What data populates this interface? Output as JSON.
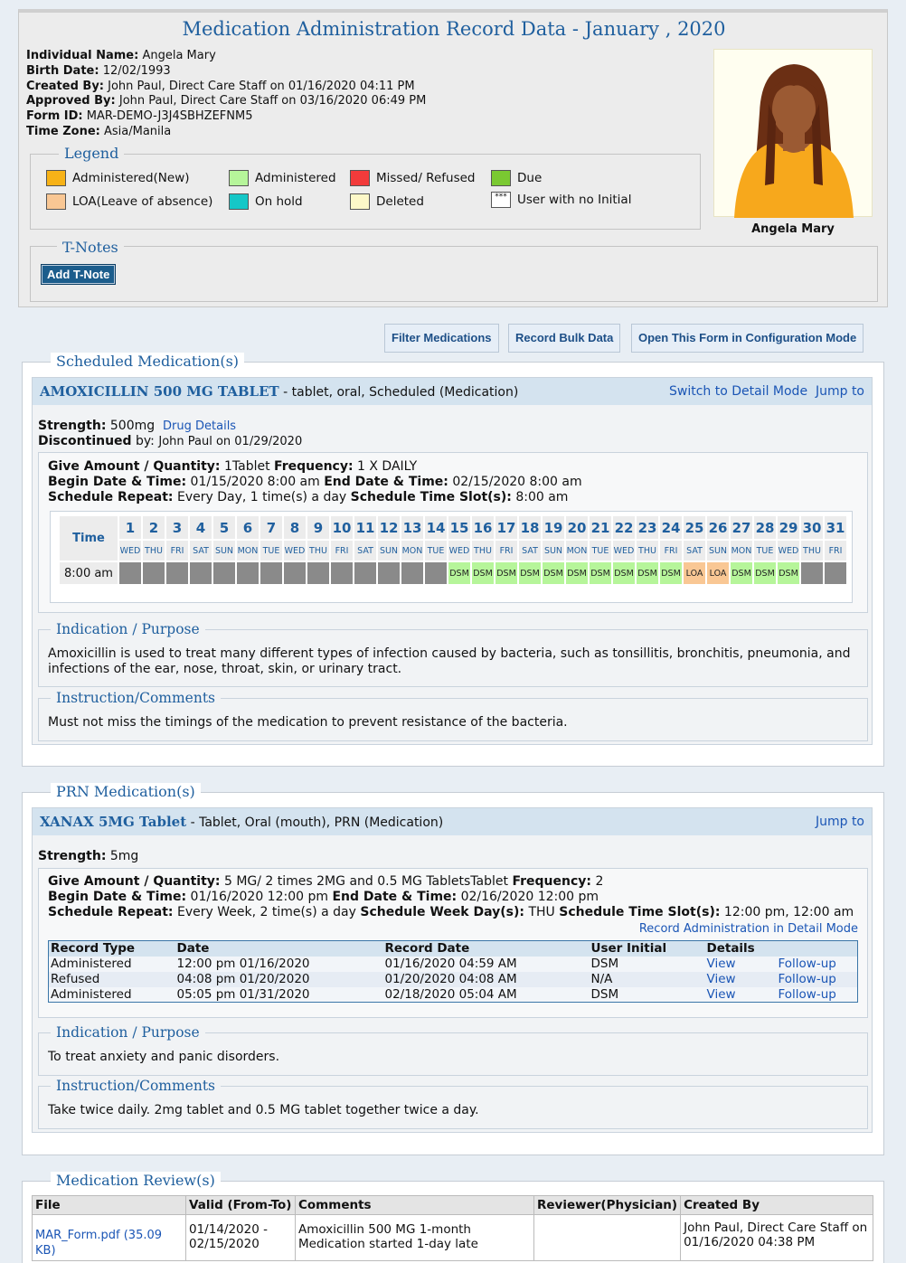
{
  "header": {
    "title": "Medication Administration Record Data - January , 2020",
    "info": [
      {
        "label": "Individual Name:",
        "value": "Angela Mary"
      },
      {
        "label": "Birth Date:",
        "value": "12/02/1993"
      },
      {
        "label": "Created By:",
        "value": "John Paul, Direct Care Staff on 01/16/2020 04:11 PM"
      },
      {
        "label": "Approved By:",
        "value": "John Paul, Direct Care Staff on 03/16/2020 06:49 PM"
      },
      {
        "label": "Form ID:",
        "value": "MAR-DEMO-J3J4SBHZEFNM5"
      },
      {
        "label": "Time Zone:",
        "value": "Asia/Manila"
      }
    ],
    "photo_name": "Angela Mary"
  },
  "legend": {
    "title": "Legend",
    "items": [
      {
        "label": "Administered(New)",
        "color": "#f7b217"
      },
      {
        "label": "Administered",
        "color": "#b6f59a"
      },
      {
        "label": "Missed/ Refused",
        "color": "#f23b3b"
      },
      {
        "label": "Due",
        "color": "#7ac931"
      },
      {
        "label": "LOA(Leave of absence)",
        "color": "#f9c794"
      },
      {
        "label": "On hold",
        "color": "#15c7c7"
      },
      {
        "label": "Deleted",
        "color": "#fdf8c8"
      },
      {
        "label": "User with no Initial",
        "color": "#ffffff",
        "glyph": "***"
      }
    ]
  },
  "tnotes": {
    "title": "T-Notes",
    "add_label": "Add T-Note"
  },
  "toolbar": {
    "filter": "Filter Medications",
    "bulk": "Record Bulk Data",
    "config": "Open This Form in Configuration Mode"
  },
  "scheduled": {
    "title": "Scheduled Medication(s)",
    "med": {
      "name": "AMOXICILLIN 500 MG TABLET",
      "desc": " - tablet, oral, Scheduled (Medication)",
      "switch_link": "Switch to Detail Mode",
      "jump_link": "Jump to",
      "strength_label": "Strength:",
      "strength": "500mg",
      "drug_details": "Drug Details",
      "disc_label": "Discontinued",
      "disc_by": "by:",
      "disc_value": "John Paul on 01/29/2020",
      "give_label": "Give Amount / Quantity:",
      "give_value": "1Tablet",
      "freq_label": "Frequency:",
      "freq_value": "1 X DAILY",
      "begin_label": "Begin Date & Time:",
      "begin_value": "01/15/2020 8:00 am",
      "end_label": "End Date & Time:",
      "end_value": "02/15/2020 8:00 am",
      "repeat_label": "Schedule Repeat:",
      "repeat_value": "Every Day, 1 time(s) a day",
      "slot_label": "Schedule Time Slot(s):",
      "slot_value": "8:00 am",
      "calendar": {
        "time_header": "Time",
        "days": [
          "1",
          "2",
          "3",
          "4",
          "5",
          "6",
          "7",
          "8",
          "9",
          "10",
          "11",
          "12",
          "13",
          "14",
          "15",
          "16",
          "17",
          "18",
          "19",
          "20",
          "21",
          "22",
          "23",
          "24",
          "25",
          "26",
          "27",
          "28",
          "29",
          "30",
          "31"
        ],
        "weekdays": [
          "WED",
          "THU",
          "FRI",
          "SAT",
          "SUN",
          "MON",
          "TUE",
          "WED",
          "THU",
          "FRI",
          "SAT",
          "SUN",
          "MON",
          "TUE",
          "WED",
          "THU",
          "FRI",
          "SAT",
          "SUN",
          "MON",
          "TUE",
          "WED",
          "THU",
          "FRI",
          "SAT",
          "SUN",
          "MON",
          "TUE",
          "WED",
          "THU",
          "FRI"
        ],
        "slot_time": "8:00 am",
        "cells": [
          "",
          "",
          "",
          "",
          "",
          "",
          "",
          "",
          "",
          "",
          "",
          "",
          "",
          "",
          "DSM",
          "DSM",
          "DSM",
          "DSM",
          "DSM",
          "DSM",
          "DSM",
          "DSM",
          "DSM",
          "DSM",
          "LOA",
          "LOA",
          "DSM",
          "DSM",
          "DSM",
          "",
          ""
        ],
        "cell_states": [
          "grey",
          "grey",
          "grey",
          "grey",
          "grey",
          "grey",
          "grey",
          "grey",
          "grey",
          "grey",
          "grey",
          "grey",
          "grey",
          "grey",
          "dsm",
          "dsm",
          "dsm",
          "dsm",
          "dsm",
          "dsm",
          "dsm",
          "dsm",
          "dsm",
          "dsm",
          "loa",
          "loa",
          "dsm",
          "dsm",
          "dsm",
          "grey",
          "grey"
        ]
      },
      "indication_title": "Indication / Purpose",
      "indication": "Amoxicillin is used to treat many different types of infection caused by bacteria, such as tonsillitis, bronchitis, pneumonia, and infections of the ear, nose, throat, skin, or urinary tract.",
      "instruction_title": "Instruction/Comments",
      "instruction": "Must not miss the timings of the medication to prevent resistance of the bacteria."
    }
  },
  "prn": {
    "title": "PRN Medication(s)",
    "med": {
      "name": "XANAX 5MG Tablet",
      "desc": " - Tablet, Oral (mouth), PRN (Medication)",
      "jump_link": "Jump to",
      "strength_label": "Strength:",
      "strength": "5mg",
      "give_label": "Give Amount / Quantity:",
      "give_value": "5 MG/ 2 times 2MG and 0.5 MG TabletsTablet",
      "freq_label": "Frequency:",
      "freq_value": "2",
      "begin_label": "Begin Date & Time:",
      "begin_value": "01/16/2020 12:00 pm",
      "end_label": "End Date & Time:",
      "end_value": "02/16/2020 12:00 pm",
      "repeat_label": "Schedule Repeat:",
      "repeat_value": "Every Week, 2 time(s) a day",
      "weekday_label": "Schedule Week Day(s):",
      "weekday_value": "THU",
      "slot_label": "Schedule Time Slot(s):",
      "slot_value": "12:00 pm, 12:00 am",
      "record_link": "Record Administration in Detail Mode",
      "records": {
        "headers": [
          "Record Type",
          "Date",
          "Record Date",
          "User Initial",
          "Details"
        ],
        "rows": [
          {
            "type": "Administered",
            "date": "12:00 pm 01/16/2020",
            "record_date": "01/16/2020 04:59 AM",
            "initial": "DSM",
            "view": "View",
            "follow": "Follow-up"
          },
          {
            "type": "Refused",
            "date": "04:08 pm 01/20/2020",
            "record_date": "01/20/2020 04:08 AM",
            "initial": "N/A",
            "view": "View",
            "follow": "Follow-up"
          },
          {
            "type": "Administered",
            "date": "05:05 pm 01/31/2020",
            "record_date": "02/18/2020 05:04 AM",
            "initial": "DSM",
            "view": "View",
            "follow": "Follow-up"
          }
        ]
      },
      "indication_title": "Indication / Purpose",
      "indication": "To treat anxiety and panic disorders.",
      "instruction_title": "Instruction/Comments",
      "instruction": "Take twice daily. 2mg tablet and 0.5 MG tablet together twice a day."
    }
  },
  "review": {
    "title": "Medication Review(s)",
    "headers": [
      "File",
      "Valid (From-To)",
      "Comments",
      "Reviewer(Physician)",
      "Created By"
    ],
    "rows": [
      {
        "file": "MAR_Form.pdf (35.09 KB)",
        "valid": "01/14/2020 - 02/15/2020",
        "comments": "Amoxicillin 500 MG 1-month Medication started 1-day late",
        "reviewer": "",
        "created": "John Paul, Direct Care Staff on 01/16/2020 04:38 PM"
      }
    ]
  }
}
